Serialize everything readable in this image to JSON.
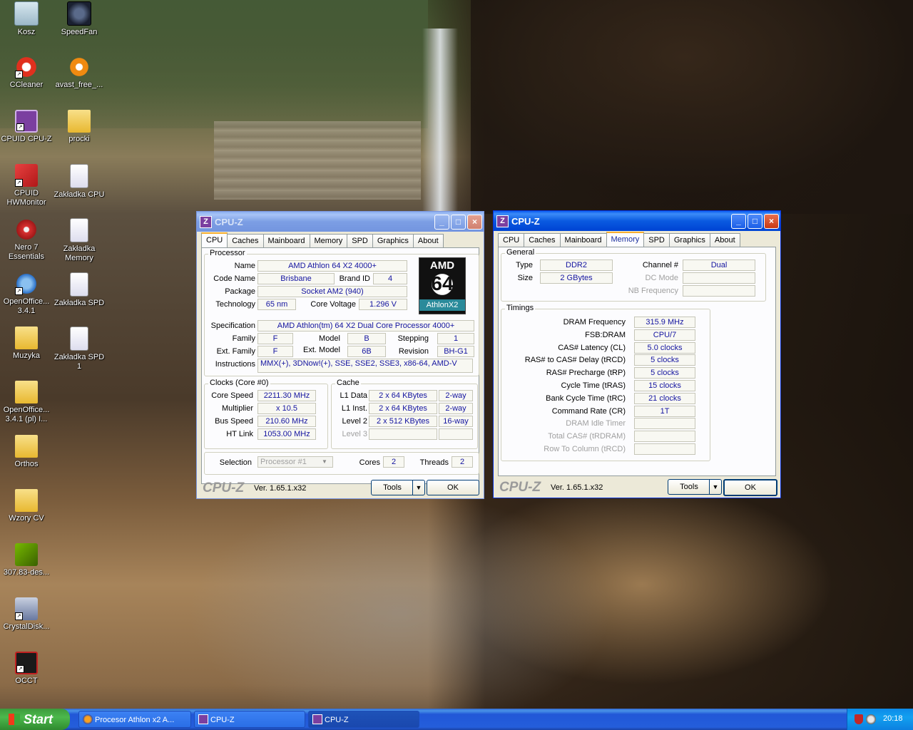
{
  "desktop": {
    "icons": [
      {
        "label": "Kosz"
      },
      {
        "label": "SpeedFan"
      },
      {
        "label": "CCleaner"
      },
      {
        "label": "avast_free_..."
      },
      {
        "label": "CPUID CPU-Z"
      },
      {
        "label": "procki"
      },
      {
        "label": "CPUID HWMonitor"
      },
      {
        "label": "Zakładka CPU"
      },
      {
        "label": "Nero 7 Essentials"
      },
      {
        "label": "Zakładka Memory"
      },
      {
        "label": "OpenOffice... 3.4.1"
      },
      {
        "label": "Zakładka SPD"
      },
      {
        "label": "Muzyka"
      },
      {
        "label": "Zakładka SPD 1"
      },
      {
        "label": "OpenOffice... 3.4.1 (pl) I..."
      },
      {
        "label": "Orthos"
      },
      {
        "label": "Wzory CV"
      },
      {
        "label": "307.83-des..."
      },
      {
        "label": "CrystalDisk..."
      },
      {
        "label": "OCCT"
      }
    ]
  },
  "window_cpu": {
    "title": "CPU-Z",
    "tabs": [
      "CPU",
      "Caches",
      "Mainboard",
      "Memory",
      "SPD",
      "Graphics",
      "About"
    ],
    "active_tab": "CPU",
    "processor": {
      "legend": "Processor",
      "name_label": "Name",
      "name": "AMD Athlon 64 X2 4000+",
      "codename_label": "Code Name",
      "codename": "Brisbane",
      "brandid_label": "Brand ID",
      "brandid": "4",
      "package_label": "Package",
      "package": "Socket AM2 (940)",
      "technology_label": "Technology",
      "technology": "65 nm",
      "voltage_label": "Core Voltage",
      "voltage": "1.296 V",
      "spec_label": "Specification",
      "spec": "AMD Athlon(tm) 64 X2 Dual Core Processor 4000+",
      "family_label": "Family",
      "family": "F",
      "model_label": "Model",
      "model": "B",
      "stepping_label": "Stepping",
      "stepping": "1",
      "extfamily_label": "Ext. Family",
      "extfamily": "F",
      "extmodel_label": "Ext. Model",
      "extmodel": "6B",
      "revision_label": "Revision",
      "revision": "BH-G1",
      "instructions_label": "Instructions",
      "instructions": "MMX(+), 3DNow!(+), SSE, SSE2, SSE3, x86-64, AMD-V",
      "logo_top": "AMD",
      "logo_mid": "64",
      "logo_bottom": "AthlonX2"
    },
    "clocks": {
      "legend": "Clocks (Core #0)",
      "corespeed_label": "Core Speed",
      "corespeed": "2211.30 MHz",
      "multiplier_label": "Multiplier",
      "multiplier": "x 10.5",
      "busspeed_label": "Bus Speed",
      "busspeed": "210.60 MHz",
      "htlink_label": "HT Link",
      "htlink": "1053.00 MHz"
    },
    "cache": {
      "legend": "Cache",
      "l1data_label": "L1 Data",
      "l1data": "2 x 64 KBytes",
      "l1data_way": "2-way",
      "l1inst_label": "L1 Inst.",
      "l1inst": "2 x 64 KBytes",
      "l1inst_way": "2-way",
      "level2_label": "Level 2",
      "level2": "2 x 512 KBytes",
      "level2_way": "16-way",
      "level3_label": "Level 3"
    },
    "footer": {
      "selection_label": "Selection",
      "selection": "Processor #1",
      "cores_label": "Cores",
      "cores": "2",
      "threads_label": "Threads",
      "threads": "2"
    },
    "brand": "CPU-Z",
    "version": "Ver. 1.65.1.x32",
    "tools_label": "Tools",
    "ok_label": "OK"
  },
  "window_mem": {
    "title": "CPU-Z",
    "tabs": [
      "CPU",
      "Caches",
      "Mainboard",
      "Memory",
      "SPD",
      "Graphics",
      "About"
    ],
    "active_tab": "Memory",
    "general": {
      "legend": "General",
      "type_label": "Type",
      "type": "DDR2",
      "size_label": "Size",
      "size": "2 GBytes",
      "channel_label": "Channel #",
      "channel": "Dual",
      "dcmode_label": "DC Mode",
      "nbfreq_label": "NB Frequency"
    },
    "timings": {
      "legend": "Timings",
      "rows": [
        {
          "label": "DRAM Frequency",
          "value": "315.9 MHz"
        },
        {
          "label": "FSB:DRAM",
          "value": "CPU/7"
        },
        {
          "label": "CAS# Latency (CL)",
          "value": "5.0 clocks"
        },
        {
          "label": "RAS# to CAS# Delay (tRCD)",
          "value": "5 clocks"
        },
        {
          "label": "RAS# Precharge (tRP)",
          "value": "5 clocks"
        },
        {
          "label": "Cycle Time (tRAS)",
          "value": "15 clocks"
        },
        {
          "label": "Bank Cycle Time (tRC)",
          "value": "21 clocks"
        },
        {
          "label": "Command Rate (CR)",
          "value": "1T"
        },
        {
          "label": "DRAM Idle Timer",
          "value": ""
        },
        {
          "label": "Total CAS# (tRDRAM)",
          "value": ""
        },
        {
          "label": "Row To Column (tRCD)",
          "value": ""
        }
      ]
    },
    "brand": "CPU-Z",
    "version": "Ver. 1.65.1.x32",
    "tools_label": "Tools",
    "ok_label": "OK"
  },
  "taskbar": {
    "start_label": "Start",
    "tasks": [
      {
        "label": "Procesor Athlon x2 A..."
      },
      {
        "label": "CPU-Z"
      },
      {
        "label": "CPU-Z"
      }
    ],
    "clock": "20:18"
  }
}
